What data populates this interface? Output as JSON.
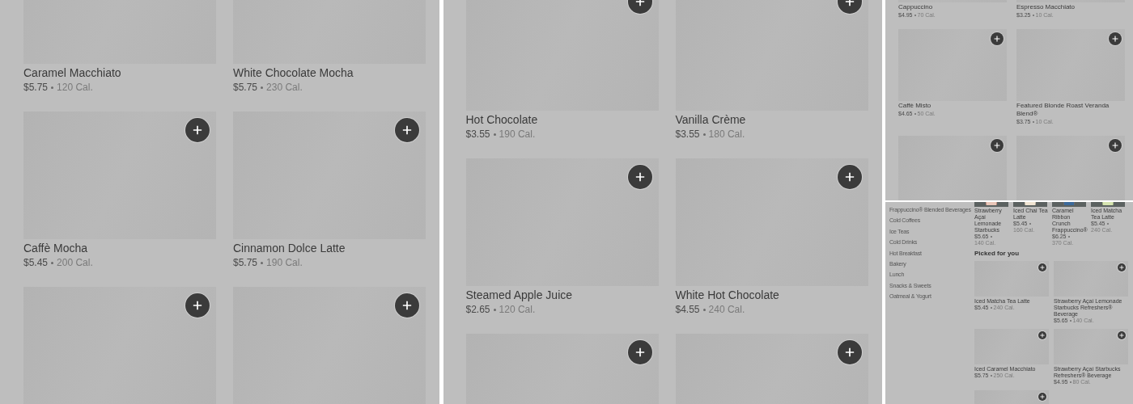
{
  "panels": [
    {
      "kind": "grid",
      "rows": [
        [
          {
            "name": "Caramel Macchiato",
            "price": "$5.75",
            "calories": "120 Cal."
          },
          {
            "name": "White Chocolate Mocha",
            "price": "$5.75",
            "calories": "230 Cal."
          }
        ],
        [
          {
            "name": "Caffè Mocha",
            "price": "$5.45",
            "calories": "200 Cal.",
            "add_button": true
          },
          {
            "name": "Cinnamon Dolce Latte",
            "price": "$5.75",
            "calories": "190 Cal.",
            "add_button": true
          }
        ],
        [
          {
            "add_button": true
          },
          {
            "add_button": true
          }
        ]
      ]
    },
    {
      "kind": "grid",
      "rows": [
        [
          {
            "name": "Hot Chocolate",
            "price": "$3.55",
            "calories": "190 Cal.",
            "add_button": true
          },
          {
            "name": "Vanilla Crème",
            "price": "$3.55",
            "calories": "180 Cal.",
            "add_button": true
          }
        ],
        [
          {
            "name": "Steamed Apple Juice",
            "price": "$2.65",
            "calories": "120 Cal.",
            "add_button": true
          },
          {
            "name": "White Hot Chocolate",
            "price": "$4.55",
            "calories": "240 Cal.",
            "add_button": true
          }
        ],
        [
          {
            "add_button": true
          },
          {
            "add_button": true
          }
        ]
      ]
    },
    {
      "kind": "compact",
      "rows": [
        [
          {
            "name": "Cappuccino",
            "price": "$4.95",
            "calories": "70 Cal."
          },
          {
            "name": "Espresso Macchiato",
            "price": "$3.25",
            "calories": "10 Cal."
          }
        ],
        [
          {
            "name": "Caffè Misto",
            "price": "$4.65",
            "calories": "50 Cal.",
            "add_button": true
          },
          {
            "name": "Featured Blonde Roast Veranda Blend®",
            "price": "$3.75",
            "calories": "10 Cal.",
            "add_button": true
          }
        ],
        [
          {
            "add_button": true
          },
          {
            "add_button": true
          }
        ]
      ]
    },
    {
      "kind": "menu",
      "categories": [
        "Frappuccino® Blended Beverages",
        "Cold Coffees",
        "Ice Teas",
        "Cold Drinks",
        "Hot Breakfast",
        "Bakery",
        "Lunch",
        "Snacks & Sweets",
        "Oatmeal & Yogurt"
      ],
      "featured": [
        {
          "name": "Strawberry Açaí Lemonade Starbucks",
          "price": "$5.65",
          "calories": "140 Cal."
        },
        {
          "name": "Iced Chai Tea Latte",
          "price": "$5.45",
          "calories": "160 Cal."
        },
        {
          "name": "Caramel Ribbon Crunch Frappuccino®",
          "price": "$6.25",
          "calories": "370 Cal."
        },
        {
          "name": "Iced Matcha Tea Latte",
          "price": "$5.45",
          "calories": "240 Cal."
        }
      ],
      "section_title": "Picked for you",
      "rows": [
        [
          {
            "name": "Iced Matcha Tea Latte",
            "price": "$5.45",
            "calories": "240 Cal.",
            "add_button": true
          },
          {
            "name": "Strawberry Açaí Lemonade Starbucks Refreshers® Beverage",
            "price": "$5.65",
            "calories": "140 Cal.",
            "add_button": true
          }
        ],
        [
          {
            "name": "Iced Caramel Macchiato",
            "price": "$5.75",
            "calories": "250 Cal.",
            "add_button": true
          },
          {
            "name": "Strawberry Açaí Starbucks Refreshers® Beverage",
            "price": "$4.95",
            "calories": "80 Cal.",
            "add_button": true
          }
        ],
        [
          {
            "add_button": true
          }
        ]
      ]
    }
  ]
}
